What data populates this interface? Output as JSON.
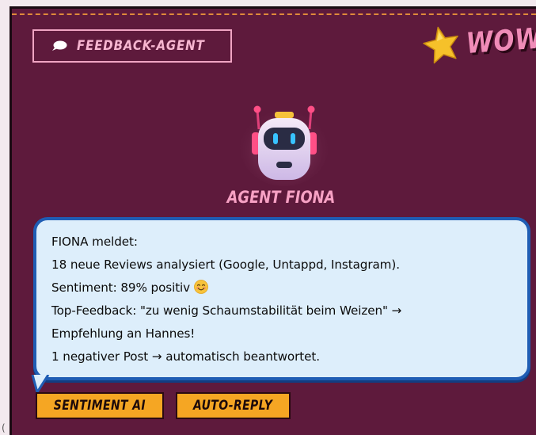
{
  "header": {
    "title": "FEEDBACK-AGENT",
    "badge_text": "WOW!"
  },
  "agent": {
    "name": "AGENT FIONA"
  },
  "message": {
    "lines": [
      "FIONA meldet:",
      "18 neue Reviews analysiert (Google, Untappd, Instagram).",
      "Sentiment: 89% positiv",
      "Top-Feedback: \"zu wenig Schaumstabilität beim Weizen\" →",
      "Empfehlung an Hannes!",
      "1 negativer Post → automatisch beantwortet."
    ]
  },
  "tags": [
    {
      "label": "SENTIMENT AI"
    },
    {
      "label": "AUTO-REPLY"
    }
  ],
  "colors": {
    "panel_bg": "#5e1a3c",
    "accent_pink": "#f7a1c4",
    "bubble_bg": "#ddeefb",
    "bubble_border": "#1f5db4",
    "tag_bg": "#f5a623"
  }
}
